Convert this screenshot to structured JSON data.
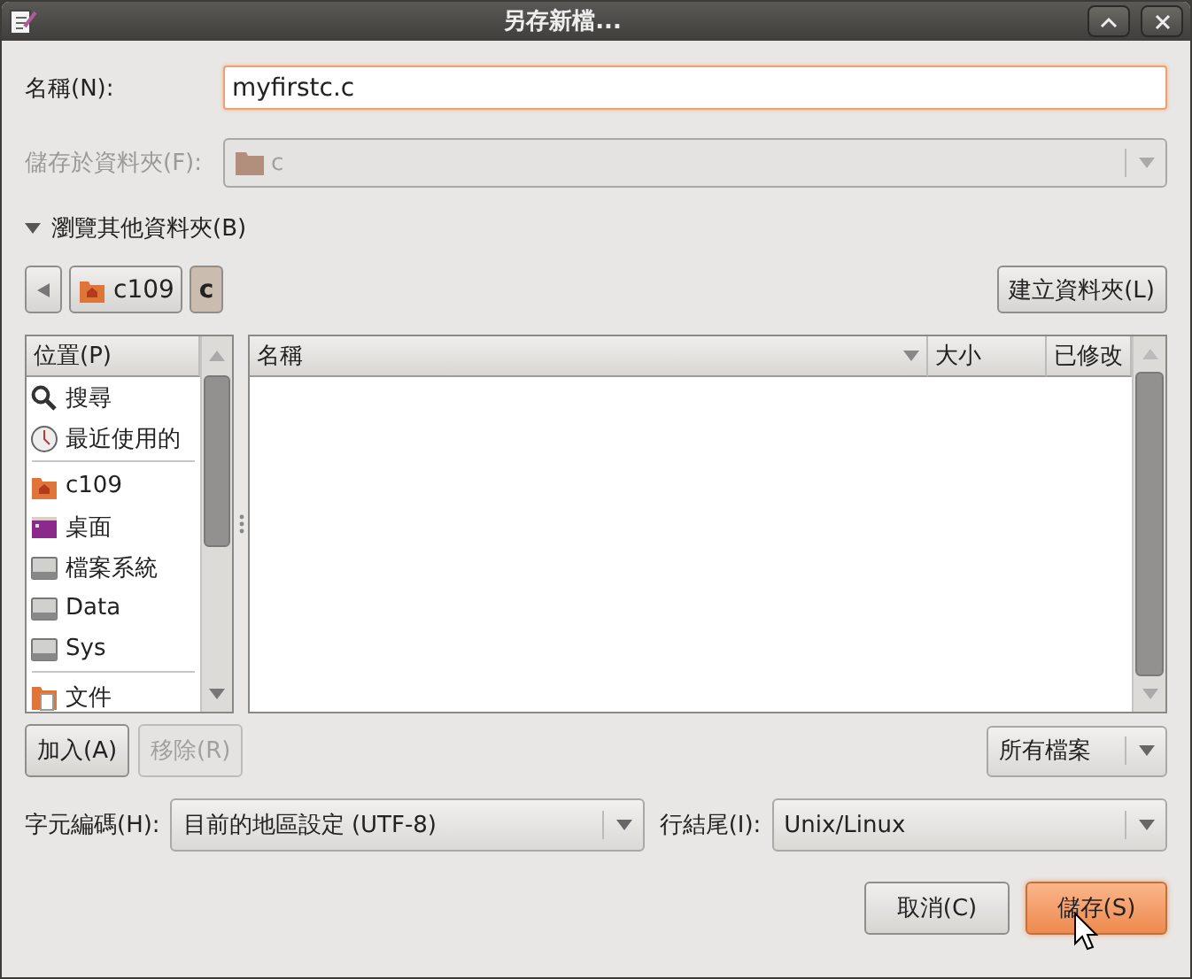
{
  "window": {
    "title": "另存新檔..."
  },
  "name_field": {
    "label": "名稱(N):",
    "value": "myfirstc.c"
  },
  "save_in": {
    "label": "儲存於資料夾(F):",
    "value": "c",
    "disabled": true
  },
  "browse_expander": {
    "label": "瀏覽其他資料夾(B)",
    "expanded": true
  },
  "path_bar": {
    "segments": [
      {
        "label": "c109",
        "kind": "home",
        "selected": false
      },
      {
        "label": "c",
        "kind": "plain",
        "selected": true
      }
    ]
  },
  "create_folder_button": "建立資料夾(L)",
  "places": {
    "header": "位置(P)",
    "groups": [
      {
        "items": [
          {
            "label": "搜尋",
            "kind": "search"
          },
          {
            "label": "最近使用的",
            "kind": "recent"
          }
        ]
      },
      {
        "items": [
          {
            "label": "c109",
            "kind": "home"
          },
          {
            "label": "桌面",
            "kind": "desktop"
          },
          {
            "label": "檔案系統",
            "kind": "drive"
          },
          {
            "label": "Data",
            "kind": "drive"
          },
          {
            "label": "Sys",
            "kind": "drive"
          }
        ]
      },
      {
        "items": [
          {
            "label": "文件",
            "kind": "documents"
          }
        ]
      }
    ]
  },
  "file_list": {
    "columns": [
      {
        "label": "名稱",
        "sorted": true
      },
      {
        "label": "大小",
        "sorted": false
      },
      {
        "label": "已修改",
        "sorted": false
      }
    ]
  },
  "add_button": {
    "label": "加入(A)",
    "disabled": false
  },
  "remove_button": {
    "label": "移除(R)",
    "disabled": true
  },
  "filter": {
    "value": "所有檔案"
  },
  "encoding": {
    "label": "字元編碼(H):",
    "value": "目前的地區設定 (UTF-8)"
  },
  "line_ending": {
    "label": "行結尾(I):",
    "value": "Unix/Linux"
  },
  "buttons": [
    {
      "label": "取消(C)",
      "kind": "cancel",
      "default": false
    },
    {
      "label": "儲存(S)",
      "kind": "save",
      "default": true
    }
  ]
}
